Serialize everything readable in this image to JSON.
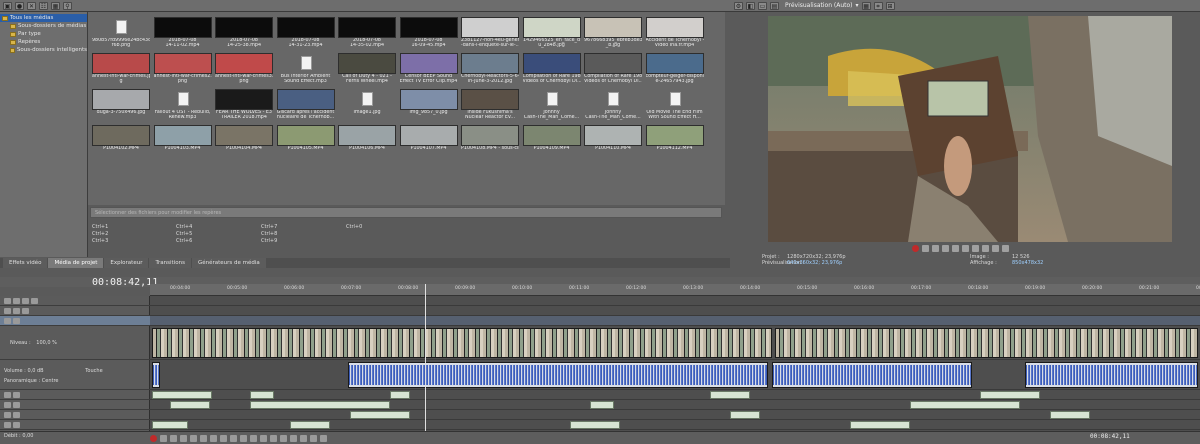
{
  "tree": {
    "items": [
      {
        "label": "Tous les médias",
        "selected": true
      },
      {
        "label": "Sous-dossiers de médias",
        "selected": false
      },
      {
        "label": "Par type",
        "selected": false
      },
      {
        "label": "Repères",
        "selected": false
      },
      {
        "label": "Sous-dossiers intelligents",
        "selected": false
      }
    ]
  },
  "media": [
    {
      "caption1": "980b57fd9996e24bc43c",
      "caption2": "f6b.png",
      "kind": "file"
    },
    {
      "caption1": "2018-07-08",
      "caption2": "14-11-02.mp4",
      "kind": "black"
    },
    {
      "caption1": "2018-07-08",
      "caption2": "14-25-38.mp4",
      "kind": "black"
    },
    {
      "caption1": "2018-07-08",
      "caption2": "14-31-23.mp4",
      "kind": "black"
    },
    {
      "caption1": "2018-07-08",
      "caption2": "14-35-02.mp4",
      "kind": "black"
    },
    {
      "caption1": "2018-07-08",
      "caption2": "16-09-45.mp4",
      "kind": "black"
    },
    {
      "caption1": "2381127-non-4eu-general",
      "caption2": "-dans-l-enquete-sur-le-...",
      "kind": "img",
      "color": "#cfcfcf"
    },
    {
      "caption1": "1429466525_en_face_d",
      "caption2": "u_2848.jpg",
      "kind": "img",
      "color": "#cfd6c6"
    },
    {
      "caption1": "9678668395_ebfeb3de3e",
      "caption2": "_b.jpg",
      "kind": "img",
      "color": "#c8c2b6"
    },
    {
      "caption1": "Accident de Tchernobyl -",
      "caption2": "Vidéo Ina.fr.mp4",
      "kind": "img",
      "color": "#d2cfcc"
    },
    {
      "caption1": "annest-intl-war-crimes.jp",
      "caption2": "g",
      "kind": "img",
      "color": "#b84a4a"
    },
    {
      "caption1": "annest-intl-war-crimes2.",
      "caption2": "png",
      "kind": "img",
      "color": "#bd4f4f"
    },
    {
      "caption1": "annest-intl-war-crimes3.",
      "caption2": "png",
      "kind": "img",
      "color": "#c04a4a"
    },
    {
      "caption1": "Bus Interior Ambient",
      "caption2": "Sound Effect.mp3",
      "kind": "file"
    },
    {
      "caption1": "Call of Duty 4 - 021 -",
      "caption2": "Ferris Wheel.mp4",
      "kind": "img",
      "color": "#4a4a40"
    },
    {
      "caption1": "Censor BEEP Sound",
      "caption2": "Effect TV Error Clip.mp4",
      "kind": "img",
      "color": "#7d6fa8"
    },
    {
      "caption1": "Chernobyl-Reactors-5-6-",
      "caption2": "in-June-3-2012.jpg",
      "kind": "img",
      "color": "#6c7d8e"
    },
    {
      "caption1": "Compilation of Rare 1986",
      "caption2": "Videos of Chernobyl Di...",
      "kind": "img",
      "color": "#3a4d7a"
    },
    {
      "caption1": "Compilation of Rare 1986",
      "caption2": "Videos of Chernobyl Di...",
      "kind": "img",
      "color": "#5a5a5a"
    },
    {
      "caption1": "compteur-geiger-disponibl",
      "caption2": "e-24657943.jpg",
      "kind": "img",
      "color": "#4b6b8c"
    },
    {
      "caption1": "duga-3-750x496.jpg",
      "caption2": "",
      "kind": "img",
      "color": "#a7a9ac"
    },
    {
      "caption1": "Fallout 4 OST - Rebuild,",
      "caption2": "Renew.mp3",
      "kind": "file"
    },
    {
      "caption1": "FEAR THE WOLVES - E3",
      "caption2": "TRAILER 2018.mp4",
      "kind": "img",
      "color": "#1a1a1a"
    },
    {
      "caption1": "Giscard après l'accident",
      "caption2": "nucléaire de Tchernob...",
      "kind": "img",
      "color": "#4a5f82"
    },
    {
      "caption1": "Image1.jpg",
      "caption2": "",
      "kind": "file"
    },
    {
      "caption1": "img_9857_0.jpg",
      "caption2": "",
      "kind": "img",
      "color": "#7e8ea8"
    },
    {
      "caption1": "Inside Fukushima's",
      "caption2": "Nuclear Reactor Ev...",
      "kind": "img",
      "color": "#5a5046"
    },
    {
      "caption1": "Johnny",
      "caption2": "Cash-The_Man_Come...",
      "kind": "file"
    },
    {
      "caption1": "Johnny",
      "caption2": "Cash-The_Man_Come...",
      "kind": "file"
    },
    {
      "caption1": "Old Movie The End Film",
      "caption2": "With Sound Effect H...",
      "kind": "file"
    },
    {
      "caption1": "P1004102.MP4",
      "caption2": "",
      "kind": "img",
      "color": "#6e6a5e"
    },
    {
      "caption1": "P1004103.MP4",
      "caption2": "",
      "kind": "img",
      "color": "#8ea0a8"
    },
    {
      "caption1": "P1004104.MP4",
      "caption2": "",
      "kind": "img",
      "color": "#7a7466"
    },
    {
      "caption1": "P1004105.MP4",
      "caption2": "",
      "kind": "img",
      "color": "#8c9a72"
    },
    {
      "caption1": "P1004106.MP4",
      "caption2": "",
      "kind": "img",
      "color": "#9aa3a6"
    },
    {
      "caption1": "P1004107.MP4",
      "caption2": "",
      "kind": "img",
      "color": "#a8acad"
    },
    {
      "caption1": "P1004108.MP4 - sous-clip",
      "caption2": "",
      "kind": "img",
      "color": "#8a8f86"
    },
    {
      "caption1": "P1004109.MP4",
      "caption2": "",
      "kind": "img",
      "color": "#7c8670"
    },
    {
      "caption1": "P1004110.MP4",
      "caption2": "",
      "kind": "img",
      "color": "#aeb3b2"
    },
    {
      "caption1": "P1004112.MP4",
      "caption2": "",
      "kind": "img",
      "color": "#8fa07a"
    }
  ],
  "filter": {
    "placeholder": "Sélectionner des fichiers pour modifier les repères"
  },
  "shortcuts": [
    "Ctrl+1",
    "Ctrl+2",
    "Ctrl+3",
    "Ctrl+4",
    "Ctrl+5",
    "Ctrl+6",
    "Ctrl+7",
    "Ctrl+8",
    "Ctrl+9",
    "Ctrl+0"
  ],
  "tabs": [
    "Effets vidéo",
    "Média de projet",
    "Explorateur",
    "Transitions",
    "Générateurs de média"
  ],
  "active_tab": "Média de projet",
  "preview": {
    "mode": "Prévisualisation (Auto)",
    "projet_label": "Projet :",
    "projet_value": "1280x720x32; 23,976p",
    "prev_label": "Prévisualisation :",
    "prev_value": "640x360x32; 23,976p",
    "image_label": "Image :",
    "image_value": "12 526",
    "affichage_label": "Affichage :",
    "affichage_value": "850x478x32"
  },
  "timeline": {
    "timecode": "00:08:42,11",
    "niveau_label": "Niveau :",
    "niveau_value": "100,0 %",
    "volume_label": "Volume :",
    "volume_value": "0,0 dB",
    "touche": "Touche",
    "panoramique_label": "Panoramique :",
    "panoramique_value": "Centre",
    "ticks": [
      "00:04:00",
      "00:05:00",
      "00:06:00",
      "00:07:00",
      "00:08:00",
      "00:09:00",
      "00:10:00",
      "00:11:00",
      "00:12:00",
      "00:13:00",
      "00:14:00",
      "00:15:00",
      "00:16:00",
      "00:17:00",
      "00:18:00",
      "00:19:00",
      "00:20:00",
      "00:21:00",
      "00:22:00"
    ],
    "debit": "Débit : 0,00",
    "bottom_time": "00:08:42,11"
  }
}
